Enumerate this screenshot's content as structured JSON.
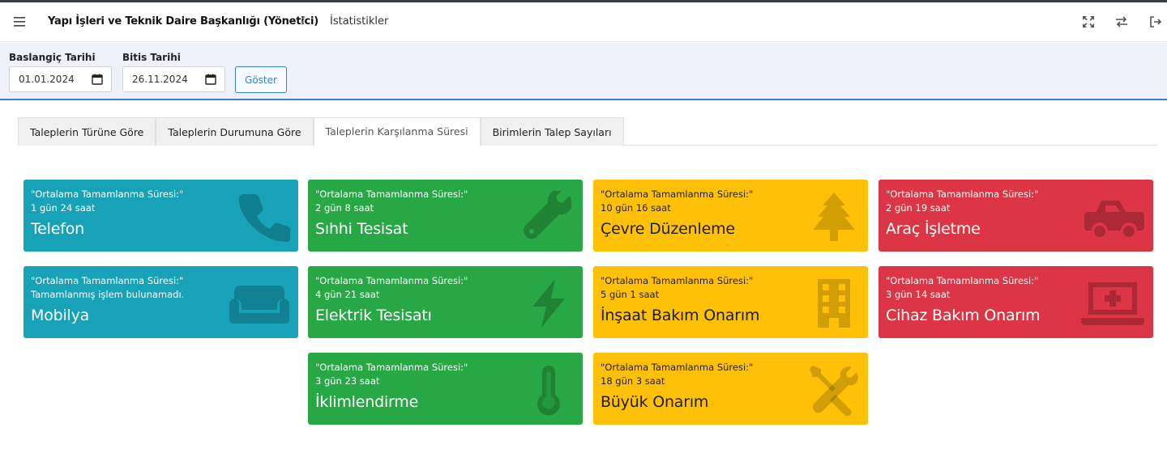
{
  "header": {
    "app_title": "Yapı İşleri ve Teknik Daire Başkanlığı (Yönetici)",
    "separator": "/",
    "breadcrumb": "İstatistikler"
  },
  "filters": {
    "start_label": "Baslangiç Tarihi",
    "start_value": "01.01.2024",
    "end_label": "Bitis Tarihi",
    "end_value": "26.11.2024",
    "show_button": "Göster"
  },
  "tabs": [
    {
      "label": "Taleplerin Türüne Göre"
    },
    {
      "label": "Taleplerin Durumuna Göre"
    },
    {
      "label": "Taleplerin Karşılanma Süresi",
      "active": true
    },
    {
      "label": "Birimlerin Talep Sayıları"
    }
  ],
  "cards": [
    {
      "subtitle": "\"Ortalama Tamamlanma Süresi:\"",
      "value": "1 gün 24 saat",
      "name": "Telefon",
      "color": "#17a2b8",
      "icon": "phone-icon"
    },
    {
      "subtitle": "\"Ortalama Tamamlanma Süresi:\"",
      "value": "2 gün 8 saat",
      "name": "Sıhhi Tesisat",
      "color": "#28a745",
      "icon": "wrench-icon"
    },
    {
      "subtitle": "\"Ortalama Tamamlanma Süresi:\"",
      "value": "10 gün 16 saat",
      "name": "Çevre Düzenleme",
      "color": "#ffc107",
      "icon": "tree-icon"
    },
    {
      "subtitle": "\"Ortalama Tamamlanma Süresi:\"",
      "value": "2 gün 19 saat",
      "name": "Araç İşletme",
      "color": "#dc3545",
      "icon": "truck-icon"
    },
    {
      "subtitle": "\"Ortalama Tamamlanma Süresi:\"",
      "value": "Tamamlanmış işlem bulunamadı.",
      "name": "Mobilya",
      "color": "#17a2b8",
      "icon": "couch-icon"
    },
    {
      "subtitle": "\"Ortalama Tamamlanma Süresi:\"",
      "value": "4 gün 21 saat",
      "name": "Elektrik Tesisatı",
      "color": "#28a745",
      "icon": "bolt-icon"
    },
    {
      "subtitle": "\"Ortalama Tamamlanma Süresi:\"",
      "value": "5 gün 1 saat",
      "name": "İnşaat Bakım Onarım",
      "color": "#ffc107",
      "icon": "building-icon"
    },
    {
      "subtitle": "\"Ortalama Tamamlanma Süresi:\"",
      "value": "3 gün 14 saat",
      "name": "Cihaz Bakım Onarım",
      "color": "#dc3545",
      "icon": "laptop-medical-icon"
    },
    {
      "subtitle": "\"Ortalama Tamamlanma Süresi:\"",
      "value": "3 gün 23 saat",
      "name": "İklimlendirme",
      "color": "#28a745",
      "icon": "thermometer-icon"
    },
    {
      "subtitle": "\"Ortalama Tamamlanma Süresi:\"",
      "value": "18 gün 3 saat",
      "name": "Büyük Onarım",
      "color": "#ffc107",
      "icon": "tools-icon"
    }
  ]
}
